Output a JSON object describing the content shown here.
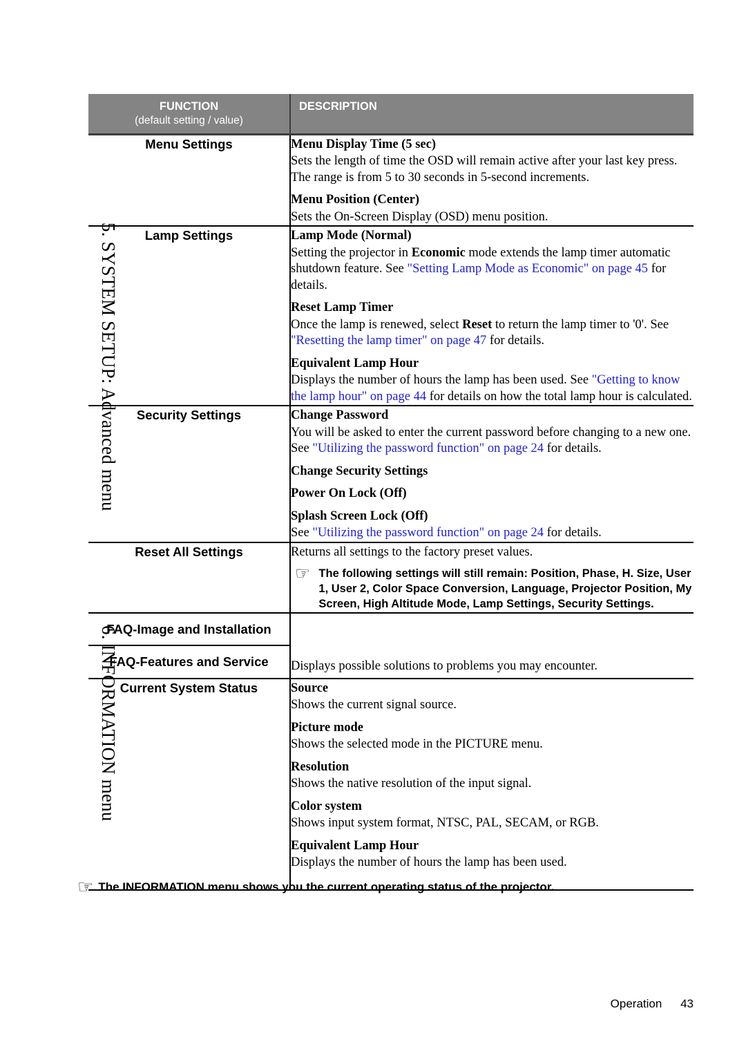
{
  "page": {
    "footer_label": "Operation",
    "footer_page_number": "43",
    "link_color": "#2222cc",
    "header_bg_color": "#848484"
  },
  "side_labels": {
    "system_setup": "5. SYSTEM SETUP: Advanced menu",
    "information": "6. INFORMATION menu"
  },
  "table": {
    "header": {
      "function": "FUNCTION",
      "function_sub": "(default setting / value)",
      "description": "DESCRIPTION"
    },
    "rows": [
      {
        "function": "Menu Settings",
        "items": [
          {
            "title": "Menu Display Time (5 sec)",
            "lines": [
              "Sets the length of time the OSD will remain active after your last key press.",
              "The range is from 5 to 30 seconds in 5-second increments."
            ]
          },
          {
            "title": "Menu Position (Center)",
            "lines": [
              "Sets the On-Screen Display (OSD) menu position."
            ]
          }
        ]
      },
      {
        "function": "Lamp Settings",
        "items": [
          {
            "title_prefix": "Lamp Mode (",
            "title_bold": "Normal",
            "title_suffix": ")",
            "body_a": "Setting the projector in ",
            "body_b": "Economic",
            "body_c": " mode extends the lamp timer automatic shutdown feature. See ",
            "link": "\"Setting Lamp Mode as Economic\" on page 45",
            "body_d": " for details."
          },
          {
            "title": "Reset Lamp Timer",
            "body_a": "Once the lamp is renewed, select ",
            "body_b": "Reset",
            "body_c": " to return the lamp timer to '0'. See ",
            "link": "\"Resetting the lamp timer\" on page 47",
            "body_d": " for details."
          },
          {
            "title": "Equivalent Lamp Hour",
            "body_a": "Displays the number of hours the lamp has been used. See ",
            "link": "\"Getting to know the lamp hour\" on page 44",
            "body_d": " for details on how the total lamp hour is calculated."
          }
        ]
      },
      {
        "function": "Security Settings",
        "items": [
          {
            "title": "Change Password",
            "body_a": "You will be asked to enter the current password before changing to a new one. See ",
            "link": "\"Utilizing the password function\" on page 24",
            "body_d": " for details."
          },
          {
            "title": "Change Security Settings"
          },
          {
            "title": "Power On Lock (Off)"
          },
          {
            "title": "Splash Screen Lock (Off)",
            "body_a": "See ",
            "link": "\"Utilizing the password function\" on page 24",
            "body_d": " for details."
          }
        ]
      },
      {
        "function": "Reset All Settings",
        "lead": "Returns all settings to the factory preset values.",
        "note_icon": "pointing-hand-icon",
        "note": "The following settings will still remain: Position, Phase, H. Size, User 1, User 2, Color Space Conversion, Language, Projector Position, My Screen, High Altitude Mode, Lamp Settings, Security Settings."
      },
      {
        "function_a": "FAQ-Image and Installation",
        "function_b": "FAQ-Features and Service",
        "description": "Displays possible solutions to problems you may encounter."
      },
      {
        "function": "Current System Status",
        "items": [
          {
            "title": "Source",
            "lines": [
              "Shows the current signal source."
            ]
          },
          {
            "title": "Picture mode",
            "body_a": "Shows the selected mode in the ",
            "body_b": "PICTURE",
            "body_c": " menu."
          },
          {
            "title": "Resolution",
            "lines": [
              "Shows the native resolution of the input signal."
            ]
          },
          {
            "title": "Color system",
            "lines": [
              "Shows input system format, NTSC, PAL, SECAM, or RGB."
            ]
          },
          {
            "title": "Equivalent Lamp Hour",
            "lines": [
              "Displays the number of hours the lamp has been used."
            ]
          }
        ]
      }
    ]
  },
  "footer_note": {
    "icon": "pointing-hand-icon",
    "text": "The INFORMATION menu shows you the current operating status of the projector."
  }
}
